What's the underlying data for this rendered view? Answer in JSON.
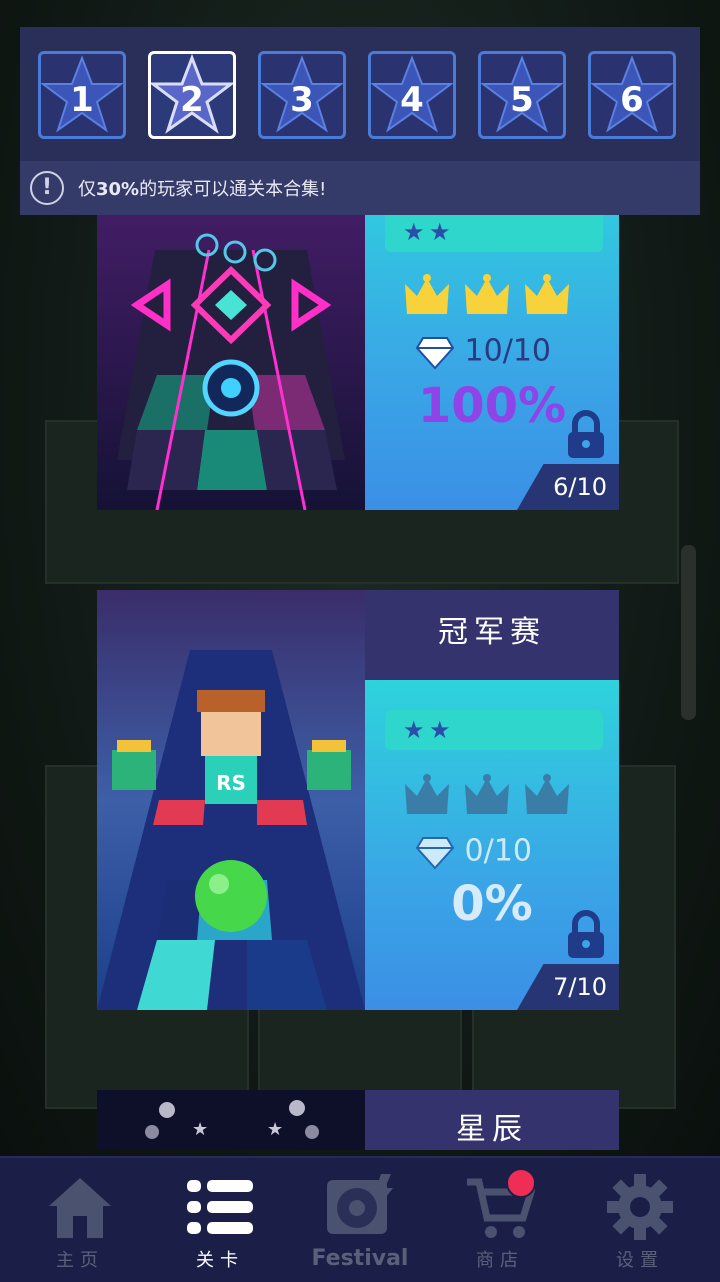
{
  "tabs": [
    {
      "label": "1",
      "active": false
    },
    {
      "label": "2",
      "active": true
    },
    {
      "label": "3",
      "active": false
    },
    {
      "label": "4",
      "active": false
    },
    {
      "label": "5",
      "active": false
    },
    {
      "label": "6",
      "active": false
    }
  ],
  "notice": {
    "icon": "exclamation-icon",
    "prefix": "仅",
    "highlight": "30%",
    "suffix": "的玩家可以通关本合集!"
  },
  "levels": [
    {
      "title": "",
      "difficulty_stars": 2,
      "crowns_earned": 3,
      "gems": "10/10",
      "percent": "100%",
      "page": "6/10",
      "locked": true,
      "colors": {
        "percent": "#8e44e6",
        "gems": "#2a3a80"
      }
    },
    {
      "title": "冠军赛",
      "difficulty_stars": 2,
      "crowns_earned": 0,
      "gems": "0/10",
      "percent": "0%",
      "page": "7/10",
      "locked": true,
      "colors": {
        "percent": "#ffffff",
        "gems": "#ffffff"
      }
    },
    {
      "title": "星辰"
    }
  ],
  "nav": [
    {
      "label": "主页",
      "icon": "home-icon",
      "active": false
    },
    {
      "label": "关卡",
      "icon": "list-icon",
      "active": true
    },
    {
      "label": "Festival",
      "icon": "record-icon",
      "active": false
    },
    {
      "label": "商店",
      "icon": "cart-icon",
      "active": false,
      "badge": true
    },
    {
      "label": "设置",
      "icon": "gear-icon",
      "active": false
    }
  ],
  "theme": {
    "accent": "#4a7bd8",
    "badge": "#ef2d55"
  }
}
